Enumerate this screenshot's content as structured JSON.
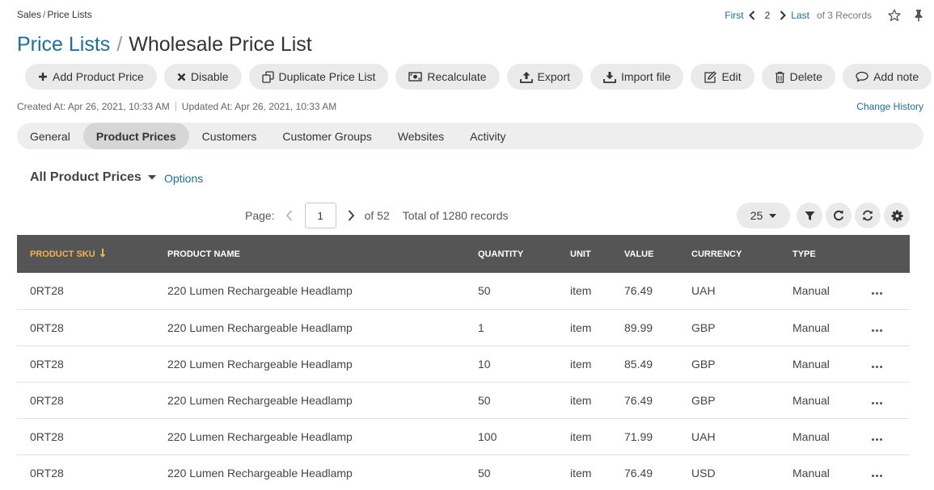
{
  "breadcrumb": {
    "parent": "Sales",
    "current": "Price Lists"
  },
  "record_nav": {
    "first": "First",
    "current": "2",
    "last": "Last",
    "summary": "of 3 Records"
  },
  "title": {
    "entity": "Price Lists",
    "separator": "/",
    "name": "Wholesale Price List"
  },
  "actions": [
    {
      "label": "Add Product Price",
      "icon": "plus-icon"
    },
    {
      "label": "Disable",
      "icon": "close-icon"
    },
    {
      "label": "Duplicate Price List",
      "icon": "copy-icon"
    },
    {
      "label": "Recalculate",
      "icon": "money-icon"
    },
    {
      "label": "Export",
      "icon": "upload-icon"
    },
    {
      "label": "Import file",
      "icon": "download-icon"
    },
    {
      "label": "Edit",
      "icon": "edit-icon"
    },
    {
      "label": "Delete",
      "icon": "trash-icon"
    },
    {
      "label": "Add note",
      "icon": "comment-icon"
    }
  ],
  "meta": {
    "created": "Created At: Apr 26, 2021, 10:33 AM",
    "updated": "Updated At: Apr 26, 2021, 10:33 AM",
    "change_history": "Change History"
  },
  "tabs": [
    {
      "label": "General",
      "active": false
    },
    {
      "label": "Product Prices",
      "active": true
    },
    {
      "label": "Customers",
      "active": false
    },
    {
      "label": "Customer Groups",
      "active": false
    },
    {
      "label": "Websites",
      "active": false
    },
    {
      "label": "Activity",
      "active": false
    }
  ],
  "grid": {
    "title": "All Product Prices",
    "options": "Options",
    "pager": {
      "label": "Page:",
      "current": "1",
      "of": "of 52",
      "total": "Total of 1280 records"
    },
    "page_size": "25",
    "accent_color": "#f0b44b",
    "header_color": "#555555",
    "columns": [
      "Product SKU",
      "Product Name",
      "Quantity",
      "Unit",
      "Value",
      "Currency",
      "Type"
    ],
    "rows": [
      {
        "sku": "0RT28",
        "name": "220 Lumen Rechargeable Headlamp",
        "quantity": "50",
        "unit": "item",
        "value": "76.49",
        "currency": "UAH",
        "type": "Manual"
      },
      {
        "sku": "0RT28",
        "name": "220 Lumen Rechargeable Headlamp",
        "quantity": "1",
        "unit": "item",
        "value": "89.99",
        "currency": "GBP",
        "type": "Manual"
      },
      {
        "sku": "0RT28",
        "name": "220 Lumen Rechargeable Headlamp",
        "quantity": "10",
        "unit": "item",
        "value": "85.49",
        "currency": "GBP",
        "type": "Manual"
      },
      {
        "sku": "0RT28",
        "name": "220 Lumen Rechargeable Headlamp",
        "quantity": "50",
        "unit": "item",
        "value": "76.49",
        "currency": "GBP",
        "type": "Manual"
      },
      {
        "sku": "0RT28",
        "name": "220 Lumen Rechargeable Headlamp",
        "quantity": "100",
        "unit": "item",
        "value": "71.99",
        "currency": "UAH",
        "type": "Manual"
      },
      {
        "sku": "0RT28",
        "name": "220 Lumen Rechargeable Headlamp",
        "quantity": "50",
        "unit": "item",
        "value": "76.49",
        "currency": "USD",
        "type": "Manual"
      }
    ]
  }
}
